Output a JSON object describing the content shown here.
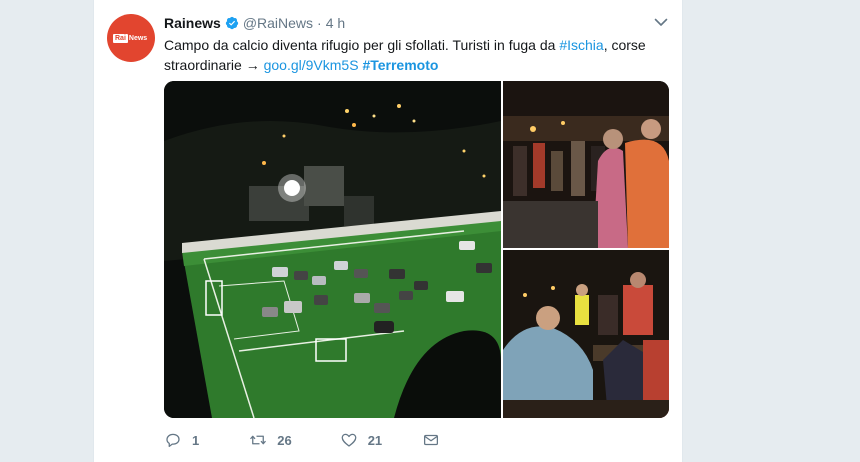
{
  "tweet": {
    "author_name": "Rainews",
    "handle": "@RaiNews",
    "separator": "·",
    "time": "4 h",
    "avatar_logo": {
      "rai": "Rai",
      "news": "News"
    },
    "text_before_link1": "Campo da calcio diventa rifugio per gli sfollati. Turisti in fuga da ",
    "hashtag_ischia": "#Ischia",
    "text_middle": ", corse straordinarie → ",
    "link": "goo.gl/9Vkm5S",
    "hashtag_terremoto": "#Terremoto"
  },
  "actions": {
    "reply_count": "1",
    "retweet_count": "26",
    "like_count": "21"
  },
  "colors": {
    "background": "#e6ecf0",
    "link_blue": "#1b95e0",
    "brand_red": "#e2452f",
    "text_gray": "#657786"
  },
  "icons": [
    "verified-badge-icon",
    "chevron-down-icon",
    "reply-icon",
    "retweet-icon",
    "like-icon",
    "direct-message-icon"
  ]
}
